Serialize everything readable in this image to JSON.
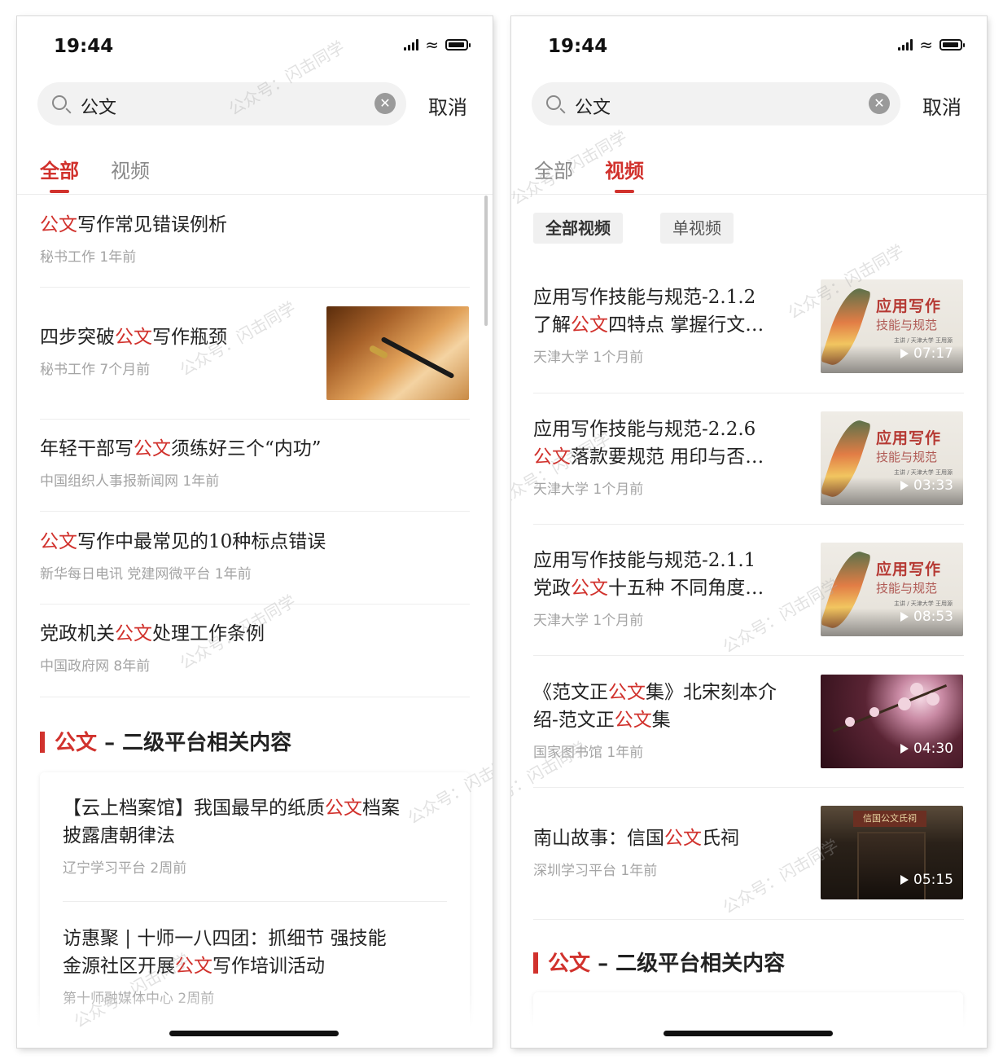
{
  "status_bar": {
    "time": "19:44"
  },
  "search": {
    "query": "公文",
    "cancel": "取消"
  },
  "left": {
    "tabs": [
      "全部",
      "视频"
    ],
    "results": [
      {
        "pre": "",
        "hl": "公文",
        "post": "写作常见错误例析",
        "meta": "秘书工作  1年前"
      },
      {
        "pre": "四步突破",
        "hl": "公文",
        "post": "写作瓶颈",
        "meta": "秘书工作  7个月前"
      },
      {
        "pre": "年轻干部写",
        "hl": "公文",
        "post": "须练好三个“内功”",
        "meta": "中国组织人事报新闻网  1年前"
      },
      {
        "pre": "",
        "hl": "公文",
        "post": "写作中最常见的10种标点错误",
        "meta": "新华每日电讯 党建网微平台  1年前"
      },
      {
        "pre": "党政机关",
        "hl": "公文",
        "post": "处理工作条例",
        "meta": "中国政府网  8年前"
      }
    ],
    "section": {
      "keyword": "公文",
      "rest": " – 二级平台相关内容"
    },
    "card_items": [
      {
        "line1_pre": "【云上档案馆】我国最早的纸质",
        "line1_hl": "公文",
        "line1_post": "档案",
        "line2_pre": "披露唐朝律法",
        "line2_hl": "",
        "line2_post": "",
        "meta": "辽宁学习平台  2周前"
      },
      {
        "line1_pre": "访惠聚 | 十师一八四团：抓细节 强技能",
        "line1_hl": "",
        "line1_post": "",
        "line2_pre": "金源社区开展",
        "line2_hl": "公文",
        "line2_post": "写作培训活动",
        "meta": "第十师融媒体中心  2周前"
      }
    ]
  },
  "right": {
    "tabs": [
      "全部",
      "视频"
    ],
    "chips": [
      "全部视频",
      "单视频"
    ],
    "videos": [
      {
        "l1_pre": "应用写作技能与规范-2.1.2",
        "l1_hl": "",
        "l1_post": "",
        "l2_pre": "了解",
        "l2_hl": "公文",
        "l2_post": "四特点 掌握行文…",
        "meta": "天津大学  1个月前",
        "duration": "07:17",
        "thumb_t1": "应用写作",
        "thumb_t2": "技能与规范",
        "thumb_t3": "主讲 / 天津大学 王用源"
      },
      {
        "l1_pre": "应用写作技能与规范-2.2.6",
        "l1_hl": "",
        "l1_post": "",
        "l2_pre": "",
        "l2_hl": "公文",
        "l2_post": "落款要规范 用印与否…",
        "meta": "天津大学  1个月前",
        "duration": "03:33",
        "thumb_t1": "应用写作",
        "thumb_t2": "技能与规范",
        "thumb_t3": "主讲 / 天津大学 王用源"
      },
      {
        "l1_pre": "应用写作技能与规范-2.1.1",
        "l1_hl": "",
        "l1_post": "",
        "l2_pre": "党政",
        "l2_hl": "公文",
        "l2_post": "十五种 不同角度…",
        "meta": "天津大学  1个月前",
        "duration": "08:53",
        "thumb_t1": "应用写作",
        "thumb_t2": "技能与规范",
        "thumb_t3": "主讲 / 天津大学 王用源"
      },
      {
        "l1_pre": "《范文正",
        "l1_hl": "公文",
        "l1_post": "集》北宋刻本介",
        "l2_pre": "绍-范文正",
        "l2_hl": "公文",
        "l2_post": "集",
        "meta": "国家图书馆  1年前",
        "duration": "04:30"
      },
      {
        "l1_pre": "南山故事：信国",
        "l1_hl": "公文",
        "l1_post": "氏祠",
        "l2_pre": "",
        "l2_hl": "",
        "l2_post": "",
        "meta": "深圳学习平台  1年前",
        "duration": "05:15",
        "thumb_sign": "信国公文氏祠"
      }
    ],
    "section": {
      "keyword": "公文",
      "rest": " – 二级平台相关内容"
    }
  },
  "watermark": "公众号：闪击同学",
  "colors": {
    "accent": "#d1322d",
    "meta": "#a4a4a4"
  }
}
